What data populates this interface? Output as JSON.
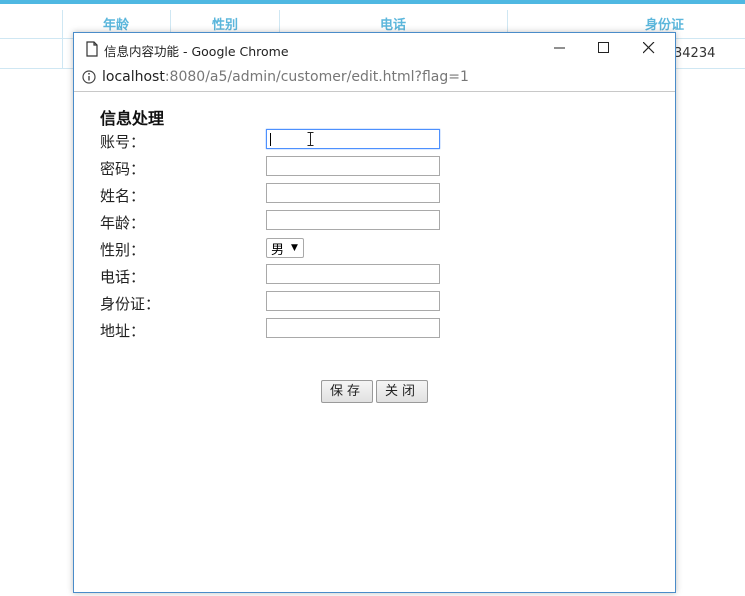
{
  "background_table": {
    "headers": [
      "年龄",
      "性别",
      "电话",
      "身份证"
    ],
    "row_values": [
      "34234"
    ]
  },
  "window": {
    "title": "信息内容功能 - Google Chrome",
    "url_host": "localhost",
    "url_rest": ":8080/a5/admin/customer/edit.html?flag=1"
  },
  "form": {
    "title": "信息处理",
    "labels": {
      "account": "账号：",
      "password": "密码：",
      "name": "姓名：",
      "age": "年龄：",
      "gender": "性别：",
      "phone": "电话：",
      "idcard": "身份证：",
      "address": "地址："
    },
    "gender_value": "男",
    "save_label": "保存",
    "close_label": "关闭"
  },
  "colors": {
    "accent": "#4fb8e2",
    "window_border": "#4a8cc9",
    "focus": "#4d90fe"
  }
}
